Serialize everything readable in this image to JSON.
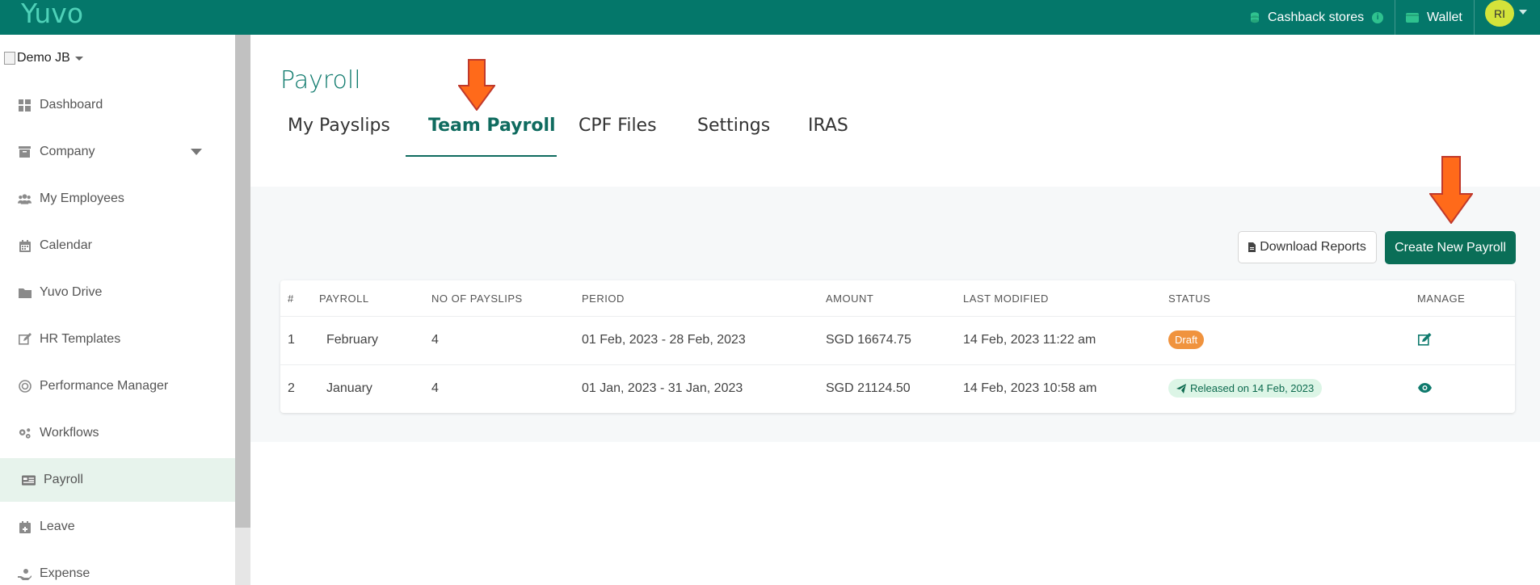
{
  "app": {
    "logo": "Yuvo"
  },
  "topbar": {
    "cashback_label": "Cashback stores",
    "wallet_label": "Wallet",
    "avatar_initials": "RI",
    "info_glyph": "i"
  },
  "sidebar": {
    "company_name": "Demo JB",
    "items": [
      {
        "label": "Dashboard",
        "icon": "dashboard-icon"
      },
      {
        "label": "Company",
        "icon": "company-icon"
      },
      {
        "label": "My Employees",
        "icon": "employees-icon"
      },
      {
        "label": "Calendar",
        "icon": "calendar-icon"
      },
      {
        "label": "Yuvo Drive",
        "icon": "folder-icon"
      },
      {
        "label": "HR Templates",
        "icon": "edit-icon"
      },
      {
        "label": "Performance Manager",
        "icon": "target-icon"
      },
      {
        "label": "Workflows",
        "icon": "gears-icon"
      },
      {
        "label": "Payroll",
        "icon": "id-card-icon"
      },
      {
        "label": "Leave",
        "icon": "calendar-plus-icon"
      },
      {
        "label": "Expense",
        "icon": "hand-coin-icon"
      }
    ]
  },
  "main": {
    "title": "Payroll",
    "tabs": [
      "My Payslips",
      "Team Payroll",
      "CPF Files",
      "Settings",
      "IRAS"
    ],
    "active_tab": "Team Payroll",
    "download_label": "Download Reports",
    "create_label": "Create New Payroll"
  },
  "table": {
    "headers": [
      "#",
      "PAYROLL",
      "NO OF PAYSLIPS",
      "PERIOD",
      "AMOUNT",
      "LAST MODIFIED",
      "STATUS",
      "MANAGE"
    ],
    "rows": [
      {
        "num": "1",
        "payroll": "February",
        "payslips": "4",
        "period": "01 Feb, 2023 - 28 Feb, 2023",
        "amount": "SGD 16674.75",
        "modified": "14 Feb, 2023 11:22 am",
        "status": "Draft"
      },
      {
        "num": "2",
        "payroll": "January",
        "payslips": "4",
        "period": "01 Jan, 2023 - 31 Jan, 2023",
        "amount": "SGD 21124.50",
        "modified": "14 Feb, 2023 10:58 am",
        "status": "Released on 14 Feb, 2023"
      }
    ]
  },
  "colors": {
    "topbar": "#04776a",
    "accent": "#0f6b5f",
    "create_button": "#0a6e57",
    "draft_badge": "#f0933e",
    "released_badge_bg": "#dcf5e6",
    "annotation_arrow": "#ff6a1a"
  }
}
